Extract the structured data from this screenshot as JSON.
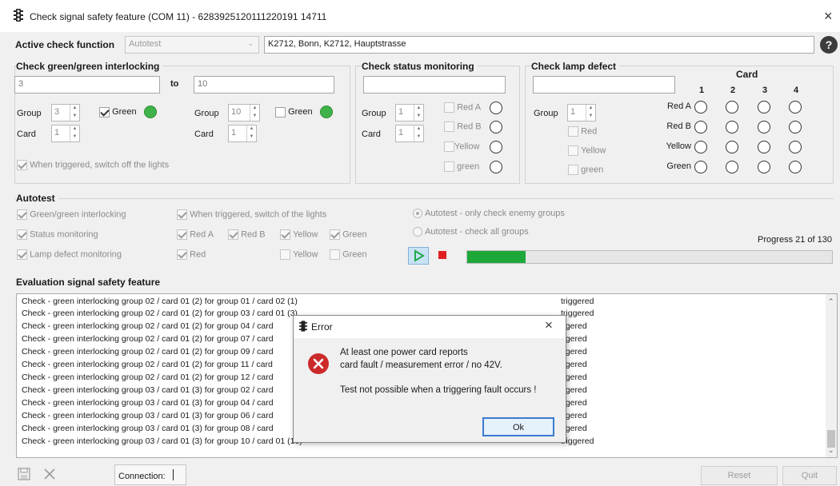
{
  "window": {
    "title": "Check signal safety feature (COM 11) - 6283925120111220191 14711",
    "close_glyph": "×"
  },
  "active": {
    "label": "Active check function",
    "select_value": "Autotest",
    "location": "K2712, Bonn, K2712, Hauptstrasse",
    "help_glyph": "?"
  },
  "gg": {
    "title": "Check green/green interlocking",
    "from": "3",
    "to_label": "to",
    "to": "10",
    "group_label": "Group",
    "card_label": "Card",
    "group_a": "3",
    "card_a": "1",
    "group_b": "10",
    "card_b": "1",
    "green_label": "Green",
    "switch_off": "When triggered, switch off the lights"
  },
  "status": {
    "title": "Check status monitoring",
    "group_label": "Group",
    "card_label": "Card",
    "group": "1",
    "card": "1",
    "red_a": "Red A",
    "red_b": "Red B",
    "yellow": "Yellow",
    "green": "green"
  },
  "lamp": {
    "title": "Check lamp defect",
    "group_label": "Group",
    "group": "1",
    "red": "Red",
    "yellow": "Yellow",
    "green": "green",
    "card_header": "Card",
    "card_numbers": [
      "1",
      "2",
      "3",
      "4"
    ],
    "rows": [
      "Red A",
      "Red B",
      "Yellow",
      "Green"
    ]
  },
  "autotest": {
    "title": "Autotest",
    "gg": "Green/green interlocking",
    "status_mon": "Status monitoring",
    "lamp_mon": "Lamp defect monitoring",
    "switch_off": "When triggered, switch of the lights",
    "red_a": "Red A",
    "red_b": "Red B",
    "yellow": "Yellow",
    "green": "Green",
    "red": "Red",
    "radio_enemy": "Autotest - only check enemy groups",
    "radio_all": "Autotest - check all groups",
    "progress_text": "Progress 21 of 130",
    "progress_value": 0.16
  },
  "evaluation": {
    "title": "Evaluation signal safety feature",
    "rows": [
      {
        "text": "Check - green interlocking group 02 / card 01 (2) for group 01 / card 02 (1)",
        "status": "triggered"
      },
      {
        "text": "Check - green interlocking group 02 / card 01 (2) for group 03 / card 01 (3)",
        "status": "triggered"
      },
      {
        "text": "Check - green interlocking group 02 / card 01 (2) for group 04 / card",
        "status": "ggered"
      },
      {
        "text": "Check - green interlocking group 02 / card 01 (2) for group 07 / card",
        "status": "ggered"
      },
      {
        "text": "Check - green interlocking group 02 / card 01 (2) for group 09 / card",
        "status": "ggered"
      },
      {
        "text": "Check - green interlocking group 02 / card 01 (2) for group 11 / card",
        "status": "ggered"
      },
      {
        "text": "Check - green interlocking group 02 / card 01 (2) for group 12 / card",
        "status": "ggered"
      },
      {
        "text": "Check - green interlocking group 03 / card 01 (3) for group 02 / card",
        "status": "ggered"
      },
      {
        "text": "Check - green interlocking group 03 / card 01 (3) for group 04 / card",
        "status": "ggered"
      },
      {
        "text": "Check - green interlocking group 03 / card 01 (3) for group 06 / card",
        "status": "ggered"
      },
      {
        "text": "Check - green interlocking group 03 / card 01 (3) for group 08 / card",
        "status": "ggered"
      },
      {
        "text": "Check - green interlocking group 03 / card 01 (3) for group 10 / card 01 (10)",
        "status": "triggered"
      }
    ]
  },
  "footer": {
    "connection_label": "Connection:",
    "reset": "Reset",
    "quit": "Quit"
  },
  "dialog": {
    "title": "Error",
    "close_glyph": "×",
    "line1": "At least one power card reports",
    "line2": "card fault / measurement error / no 42V.",
    "line3": "Test not possible when a triggering fault occurs !",
    "ok": "Ok"
  },
  "colors": {
    "green_indicator": "#3fb34a",
    "progress": "#1ea83a",
    "play": "#1fa84a",
    "stop": "#e02020",
    "error_icon": "#cc2a2a"
  }
}
